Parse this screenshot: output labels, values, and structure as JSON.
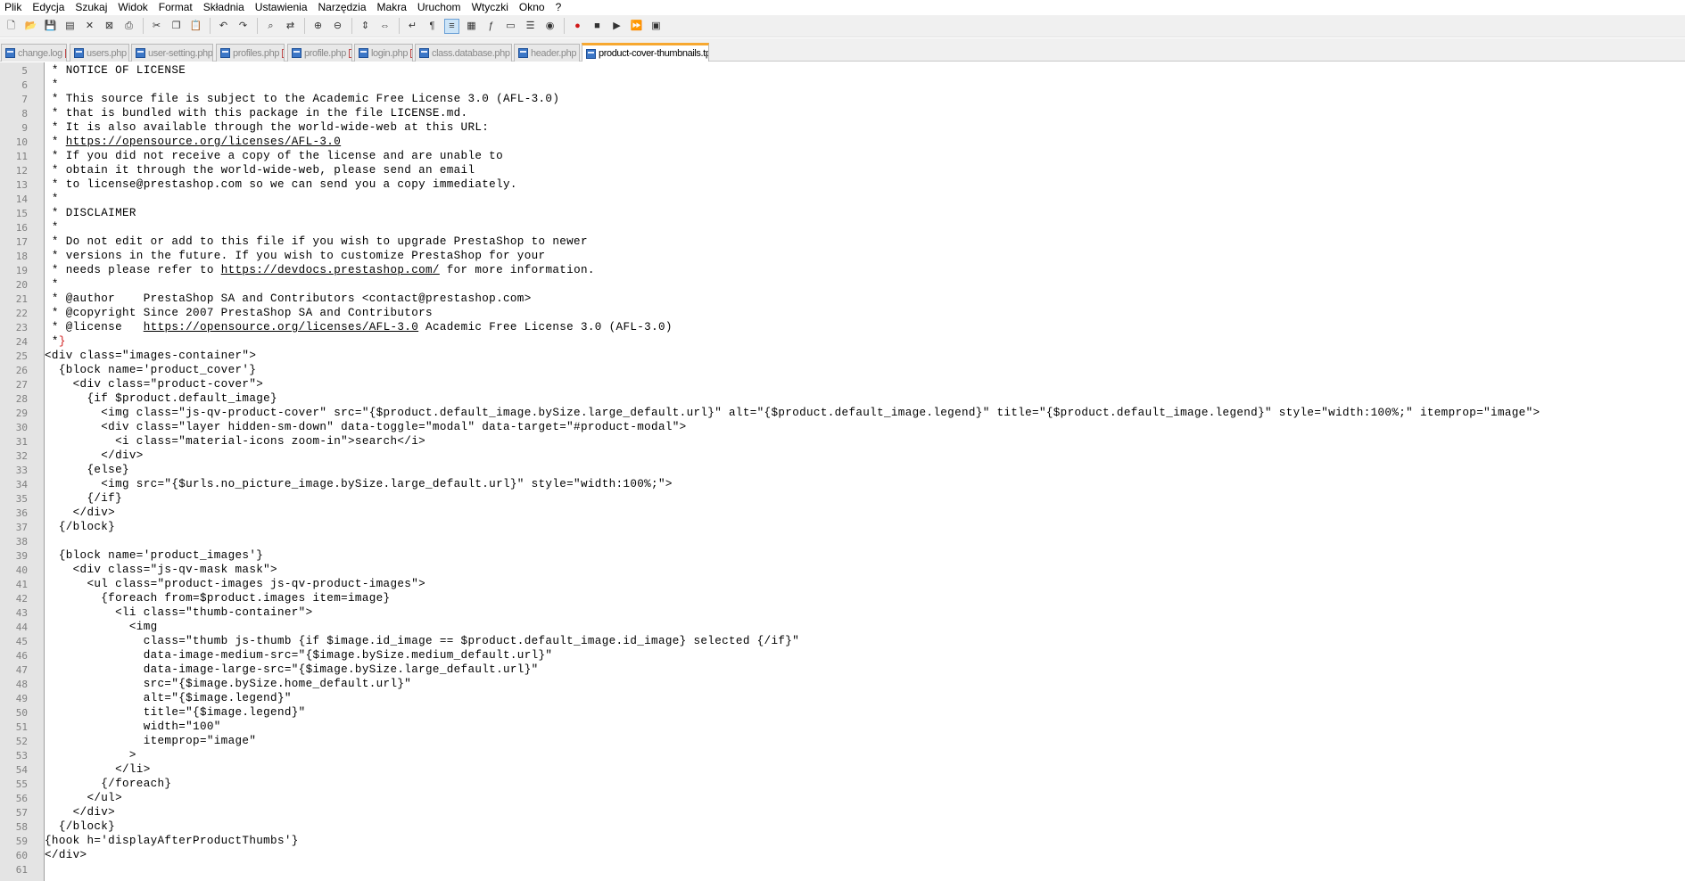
{
  "menu": [
    "Plik",
    "Edycja",
    "Szukaj",
    "Widok",
    "Format",
    "Składnia",
    "Ustawienia",
    "Narzędzia",
    "Makra",
    "Uruchom",
    "Wtyczki",
    "Okno",
    "?"
  ],
  "toolbar": {
    "buttons": [
      "new-file-icon",
      "open-file-icon",
      "save-icon",
      "save-all-icon",
      "close-icon",
      "close-all-icon",
      "print-icon",
      "cut-icon",
      "copy-icon",
      "paste-icon",
      "undo-icon",
      "redo-icon",
      "find-icon",
      "replace-icon",
      "zoom-in-icon",
      "zoom-out-icon",
      "sync-vertical-icon",
      "sync-horizontal-icon",
      "word-wrap-icon",
      "show-all-chars-icon",
      "indent-guide-icon",
      "doc-map-icon",
      "function-list-icon",
      "folder-workspace-icon",
      "doc-list-icon",
      "monitor-icon",
      "record-macro-icon",
      "stop-record-icon",
      "play-macro-icon",
      "run-macro-multiple-icon",
      "save-macro-icon"
    ]
  },
  "tabs": [
    {
      "label": "change.log",
      "active": false
    },
    {
      "label": "users.php",
      "active": false
    },
    {
      "label": "user-setting.php",
      "active": false
    },
    {
      "label": "profiles.php",
      "active": false
    },
    {
      "label": "profile.php",
      "active": false
    },
    {
      "label": "login.php",
      "active": false
    },
    {
      "label": "class.database.php",
      "active": false
    },
    {
      "label": "header.php",
      "active": false
    },
    {
      "label": "product-cover-thumbnails.tpl",
      "active": true
    }
  ],
  "colors": {
    "active_tab_accent": "#f7a830",
    "gutter": "#e4e4e4",
    "url": "#000000"
  },
  "editor": {
    "lines": [
      {
        "n": "5",
        "t": " * NOTICE OF LICENSE"
      },
      {
        "n": "6",
        "t": " *"
      },
      {
        "n": "7",
        "t": " * This source file is subject to the Academic Free License 3.0 (AFL-3.0)"
      },
      {
        "n": "8",
        "t": " * that is bundled with this package in the file LICENSE.md."
      },
      {
        "n": "9",
        "t": " * It is also available through the world-wide-web at this URL:"
      },
      {
        "n": "10",
        "t": " * ",
        "u": "https://opensource.org/licenses/AFL-3.0"
      },
      {
        "n": "11",
        "t": " * If you did not receive a copy of the license and are unable to"
      },
      {
        "n": "12",
        "t": " * obtain it through the world-wide-web, please send an email"
      },
      {
        "n": "13",
        "t": " * to license@prestashop.com so we can send you a copy immediately."
      },
      {
        "n": "14",
        "t": " *"
      },
      {
        "n": "15",
        "t": " * DISCLAIMER"
      },
      {
        "n": "16",
        "t": " *"
      },
      {
        "n": "17",
        "t": " * Do not edit or add to this file if you wish to upgrade PrestaShop to newer"
      },
      {
        "n": "18",
        "t": " * versions in the future. If you wish to customize PrestaShop for your"
      },
      {
        "n": "19",
        "t": " * needs please refer to ",
        "u": "https://devdocs.prestashop.com/",
        "a": " for more information."
      },
      {
        "n": "20",
        "t": " *"
      },
      {
        "n": "21",
        "t": " * @author    PrestaShop SA and Contributors <contact@prestashop.com>"
      },
      {
        "n": "22",
        "t": " * @copyright Since 2007 PrestaShop SA and Contributors"
      },
      {
        "n": "23",
        "t": " * @license   ",
        "u": "https://opensource.org/licenses/AFL-3.0",
        "a": " Academic Free License 3.0 (AFL-3.0)"
      },
      {
        "n": "24",
        "t": " *",
        "b": "}"
      },
      {
        "n": "25",
        "t": "<div class=\"images-container\">"
      },
      {
        "n": "26",
        "t": "  {block name='product_cover'}"
      },
      {
        "n": "27",
        "t": "    <div class=\"product-cover\">"
      },
      {
        "n": "28",
        "t": "      {if $product.default_image}"
      },
      {
        "n": "29",
        "t": "        <img class=\"js-qv-product-cover\" src=\"{$product.default_image.bySize.large_default.url}\" alt=\"{$product.default_image.legend}\" title=\"{$product.default_image.legend}\" style=\"width:100%;\" itemprop=\"image\">"
      },
      {
        "n": "30",
        "t": "        <div class=\"layer hidden-sm-down\" data-toggle=\"modal\" data-target=\"#product-modal\">"
      },
      {
        "n": "31",
        "t": "          <i class=\"material-icons zoom-in\">search</i>"
      },
      {
        "n": "32",
        "t": "        </div>"
      },
      {
        "n": "33",
        "t": "      {else}"
      },
      {
        "n": "34",
        "t": "        <img src=\"{$urls.no_picture_image.bySize.large_default.url}\" style=\"width:100%;\">"
      },
      {
        "n": "35",
        "t": "      {/if}"
      },
      {
        "n": "36",
        "t": "    </div>"
      },
      {
        "n": "37",
        "t": "  {/block}"
      },
      {
        "n": "38",
        "t": ""
      },
      {
        "n": "39",
        "t": "  {block name='product_images'}"
      },
      {
        "n": "40",
        "t": "    <div class=\"js-qv-mask mask\">"
      },
      {
        "n": "41",
        "t": "      <ul class=\"product-images js-qv-product-images\">"
      },
      {
        "n": "42",
        "t": "        {foreach from=$product.images item=image}"
      },
      {
        "n": "43",
        "t": "          <li class=\"thumb-container\">"
      },
      {
        "n": "44",
        "t": "            <img"
      },
      {
        "n": "45",
        "t": "              class=\"thumb js-thumb {if $image.id_image == $product.default_image.id_image} selected {/if}\""
      },
      {
        "n": "46",
        "t": "              data-image-medium-src=\"{$image.bySize.medium_default.url}\""
      },
      {
        "n": "47",
        "t": "              data-image-large-src=\"{$image.bySize.large_default.url}\""
      },
      {
        "n": "48",
        "t": "              src=\"{$image.bySize.home_default.url}\""
      },
      {
        "n": "49",
        "t": "              alt=\"{$image.legend}\""
      },
      {
        "n": "50",
        "t": "              title=\"{$image.legend}\""
      },
      {
        "n": "51",
        "t": "              width=\"100\""
      },
      {
        "n": "52",
        "t": "              itemprop=\"image\""
      },
      {
        "n": "53",
        "t": "            >"
      },
      {
        "n": "54",
        "t": "          </li>"
      },
      {
        "n": "55",
        "t": "        {/foreach}"
      },
      {
        "n": "56",
        "t": "      </ul>"
      },
      {
        "n": "57",
        "t": "    </div>"
      },
      {
        "n": "58",
        "t": "  {/block}"
      },
      {
        "n": "59",
        "t": "{hook h='displayAfterProductThumbs'}"
      },
      {
        "n": "60",
        "t": "</div>"
      },
      {
        "n": "61",
        "t": ""
      }
    ]
  }
}
